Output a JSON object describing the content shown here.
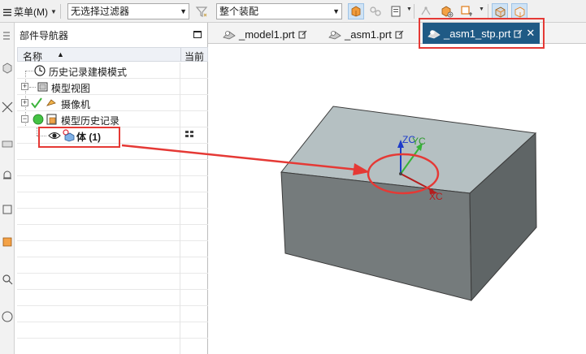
{
  "toolbar": {
    "menu_label": "菜单(M)",
    "filter_value": "无选择过滤器",
    "assembly_scope_value": "整个装配"
  },
  "navigator": {
    "title": "部件导航器",
    "col_name": "名称",
    "col_current": "当前",
    "rows": [
      {
        "label": "历史记录建模模式"
      },
      {
        "label": "模型视图"
      },
      {
        "label": "摄像机"
      },
      {
        "label": "模型历史记录"
      },
      {
        "label": "体 (1)"
      }
    ]
  },
  "tabs": [
    {
      "label": "_model1.prt"
    },
    {
      "label": "_asm1.prt"
    },
    {
      "label": "_asm1_stp.prt",
      "active": true
    }
  ],
  "viewport": {
    "axis_z": "ZC",
    "axis_y": "YC",
    "axis_x": "XC"
  },
  "colors": {
    "accent": "#1f5a85",
    "annotation_red": "#e53935",
    "box_top": "#b5c0c2",
    "box_front": "#757b7c",
    "box_side": "#5f6566"
  }
}
